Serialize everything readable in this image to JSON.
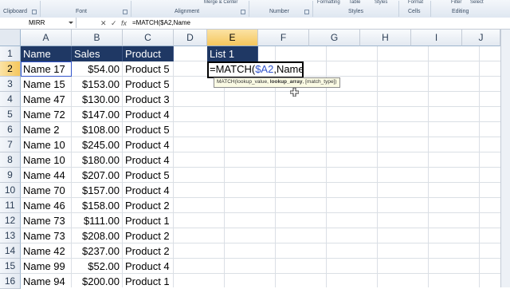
{
  "ribbon": {
    "groups": [
      "Clipboard",
      "Font",
      "Alignment",
      "Number",
      "Styles",
      "Cells",
      "Editing"
    ],
    "top_items": [
      "Merge & Center",
      "Formatting",
      "Table",
      "Styles",
      "Format",
      "Filter",
      "Select"
    ]
  },
  "formula_bar": {
    "name_box": "MIRR",
    "cancel_icon": "✕",
    "enter_icon": "✓",
    "fx_label": "fx",
    "formula": "=MATCH($A2,Name"
  },
  "columns": [
    "A",
    "B",
    "C",
    "D",
    "E",
    "F",
    "G",
    "H",
    "I",
    "J"
  ],
  "rows": [
    "1",
    "2",
    "3",
    "4",
    "5",
    "6",
    "7",
    "8",
    "9",
    "10",
    "11",
    "12",
    "13",
    "14",
    "15",
    "16"
  ],
  "table": {
    "headers": [
      "Name",
      "Sales",
      "Product"
    ],
    "data": [
      [
        "Name 17",
        "$54.00",
        "Product 5"
      ],
      [
        "Name 15",
        "$153.00",
        "Product 5"
      ],
      [
        "Name 47",
        "$130.00",
        "Product 3"
      ],
      [
        "Name 72",
        "$147.00",
        "Product 4"
      ],
      [
        "Name 2",
        "$108.00",
        "Product 5"
      ],
      [
        "Name 10",
        "$245.00",
        "Product 4"
      ],
      [
        "Name 10",
        "$180.00",
        "Product 4"
      ],
      [
        "Name 44",
        "$207.00",
        "Product 5"
      ],
      [
        "Name 70",
        "$157.00",
        "Product 4"
      ],
      [
        "Name 46",
        "$158.00",
        "Product 2"
      ],
      [
        "Name 73",
        "$111.00",
        "Product 1"
      ],
      [
        "Name 73",
        "$208.00",
        "Product 2"
      ],
      [
        "Name 42",
        "$237.00",
        "Product 2"
      ],
      [
        "Name 99",
        "$52.00",
        "Product 4"
      ],
      [
        "Name 94",
        "$200.00",
        "Product 1"
      ]
    ]
  },
  "list_header": "List 1",
  "editing_cell": {
    "prefix": "=MATCH(",
    "ref": "$A2",
    "suffix": ",Name"
  },
  "tooltip": {
    "func": "MATCH(",
    "arg1": "lookup_value, ",
    "arg2": "lookup_array",
    "arg3": ", [match_type])"
  },
  "colors": {
    "header_fill": "#1f3864",
    "selected_header": "#f5c65c",
    "ref_blue": "#3355cc"
  }
}
